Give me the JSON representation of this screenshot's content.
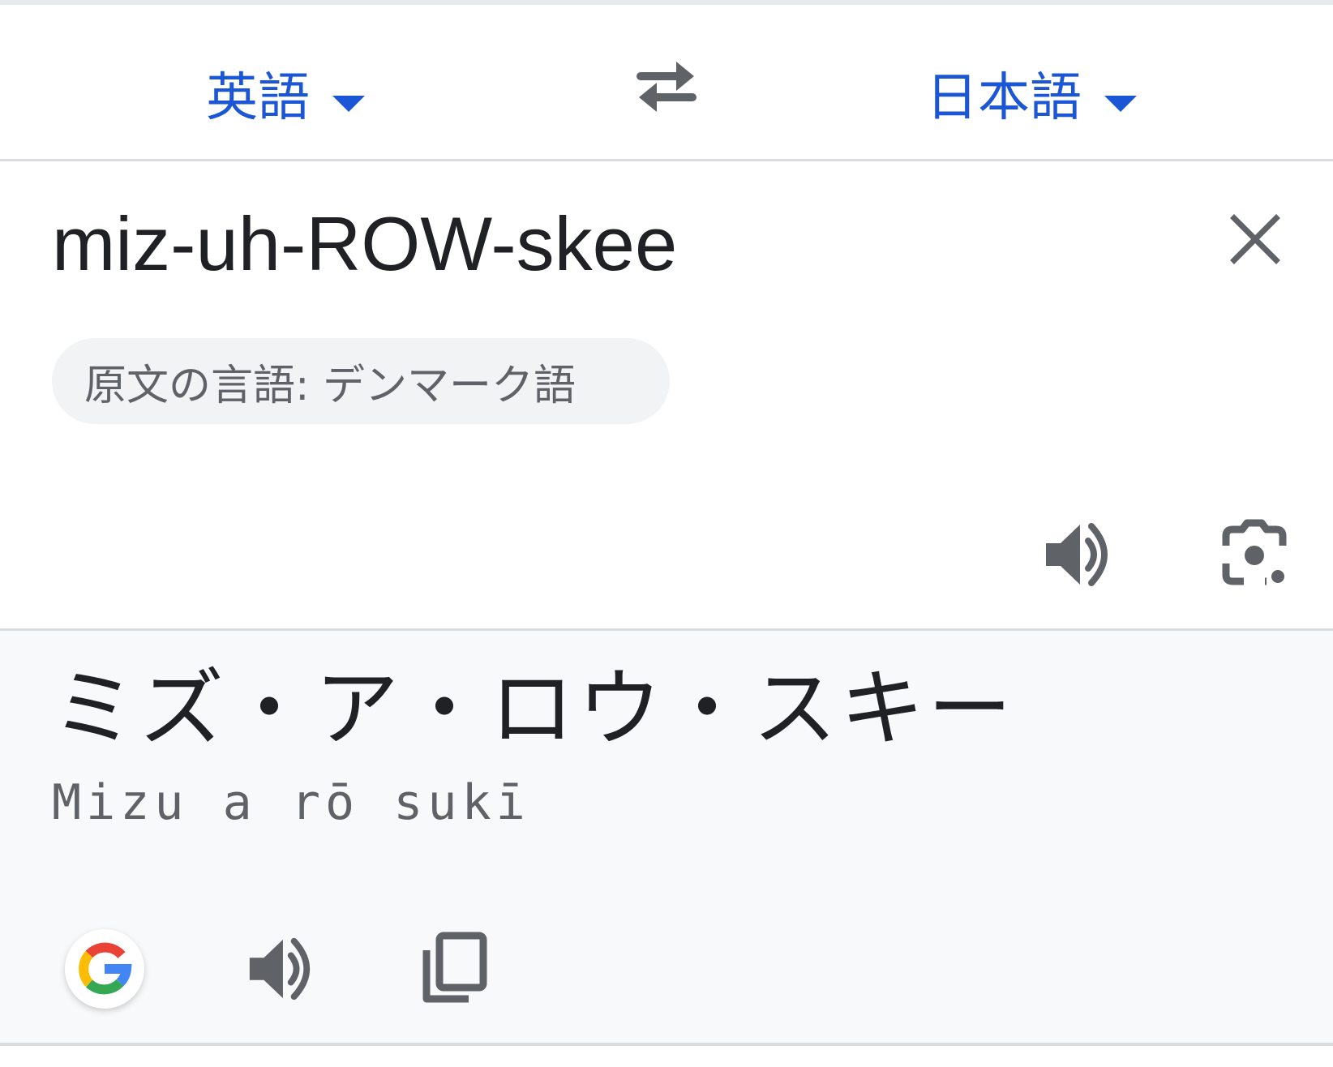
{
  "language_bar": {
    "source_language": "英語",
    "target_language": "日本語",
    "swap_icon": "swap-arrows-icon"
  },
  "source_panel": {
    "input_text": "miz-uh-ROW-skee",
    "detected_language_chip": "原文の言語: デンマーク語",
    "icons": [
      "close-icon",
      "speaker-icon",
      "camera-lens-icon"
    ]
  },
  "result_panel": {
    "translation": "ミズ・ア・ロウ・スキー",
    "romanization": "Mizu a rō sukī",
    "icons": [
      "google-g-icon",
      "speaker-icon",
      "copy-icon"
    ]
  },
  "colors": {
    "accent": "#1a56d6",
    "text": "#202124",
    "secondary_text": "#5f6368",
    "icon": "#5f6368",
    "result_background": "#f8f9fa",
    "chip_background": "#f1f3f4",
    "divider": "#dadce0"
  }
}
